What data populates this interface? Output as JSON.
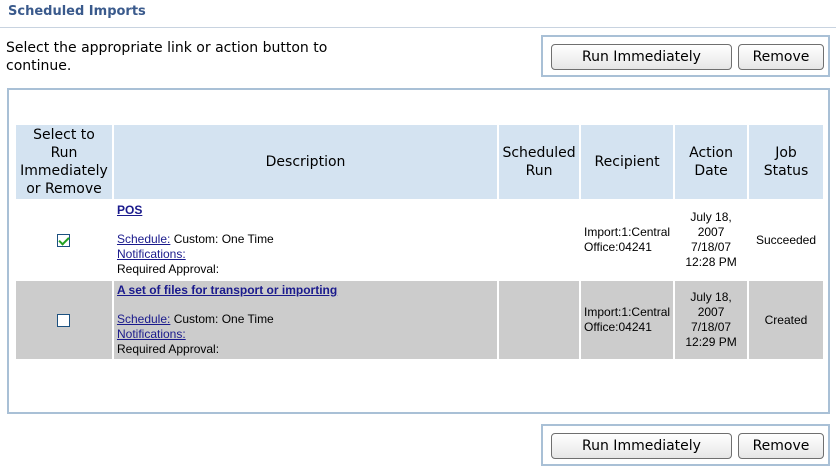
{
  "page": {
    "title": "Scheduled Imports",
    "instructions": "Select the appropriate link or action button to continue."
  },
  "actions": {
    "run_label": "Run Immediately",
    "remove_label": "Remove"
  },
  "table": {
    "headers": {
      "select": "Select to Run Immediately or Remove",
      "description": "Description",
      "scheduled_run": "Scheduled Run",
      "recipient": "Recipient",
      "action_date": "Action Date",
      "job_status": "Job Status"
    },
    "rows": [
      {
        "selected": true,
        "title": "POS",
        "schedule_label": "Schedule:",
        "schedule_value": "Custom: One Time",
        "notifications_label": "Notifications:",
        "approval": "Required Approval:",
        "scheduled_run": "",
        "recipient": "Import:1:Central Office:04241",
        "date_long": "July 18, 2007",
        "date_short": "7/18/07",
        "time": "12:28 PM",
        "status": "Succeeded"
      },
      {
        "selected": false,
        "title": "A set of files for transport or importing",
        "schedule_label": "Schedule:",
        "schedule_value": "Custom: One Time",
        "notifications_label": "Notifications:",
        "approval": "Required Approval:",
        "scheduled_run": "",
        "recipient": "Import:1:Central Office:04241",
        "date_long": "July 18, 2007",
        "date_short": "7/18/07",
        "time": "12:29 PM",
        "status": "Created"
      }
    ]
  },
  "colors": {
    "title": "#3a5a8c",
    "header_bg": "#d4e3f1",
    "row_alt_bg": "#cccccc",
    "panel_border": "#a9c0d6",
    "link": "#1a1a8c"
  }
}
